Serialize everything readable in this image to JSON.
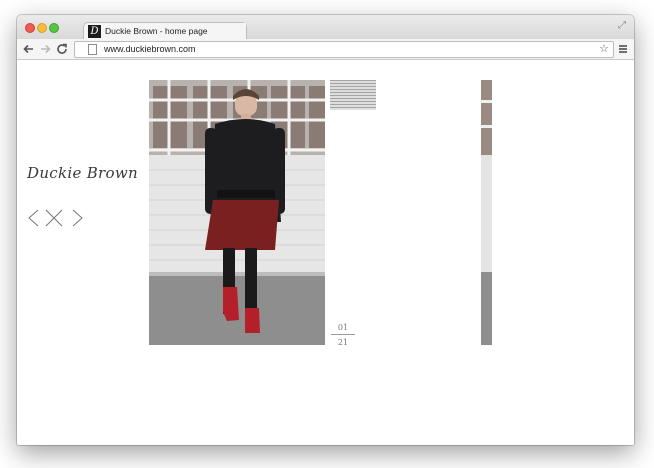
{
  "browser": {
    "tab_title": "Duckie Brown - home page",
    "favicon_letter": "D",
    "url": "www.duckiebrown.com",
    "icons": [
      "back-arrow-icon",
      "forward-arrow-icon",
      "reload-icon",
      "page-icon",
      "star-icon",
      "menu-icon",
      "fullscreen-icon"
    ]
  },
  "page": {
    "logo_text": "Duckie Brown",
    "controls": [
      "chevron-left-icon",
      "close-icon",
      "chevron-right-icon"
    ],
    "counter": {
      "current": "01",
      "total": "21"
    }
  }
}
